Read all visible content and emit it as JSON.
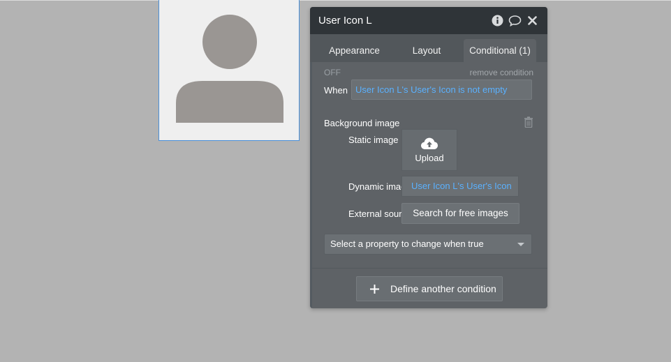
{
  "canvas": {
    "element_name": "User Icon L"
  },
  "panel": {
    "title": "User Icon L",
    "header_icons": [
      "info-icon",
      "comment-icon",
      "close-icon"
    ],
    "tabs": [
      {
        "label": "Appearance",
        "active": false
      },
      {
        "label": "Layout",
        "active": false
      },
      {
        "label": "Conditional (1)",
        "active": true
      }
    ],
    "condition": {
      "status": "OFF",
      "remove_label": "remove condition",
      "when_label": "When",
      "when_expression": "User Icon L's User's Icon is not empty"
    },
    "background": {
      "label": "Background image",
      "static_label": "Static image",
      "upload_label": "Upload",
      "dynamic_label": "Dynamic image",
      "dynamic_value": "User Icon L's User's Icon",
      "external_label": "External source",
      "search_button": "Search for free images"
    },
    "property_select": {
      "placeholder": "Select a property to change when true"
    },
    "define_button": "Define another condition"
  },
  "colors": {
    "page_bg": "#b3b3b3",
    "panel_bg": "#5e6266",
    "header_bg": "#2f3438",
    "link_blue": "#5ab1ff",
    "selection_border": "#4a90d9",
    "avatar_gray": "#9a9693"
  }
}
